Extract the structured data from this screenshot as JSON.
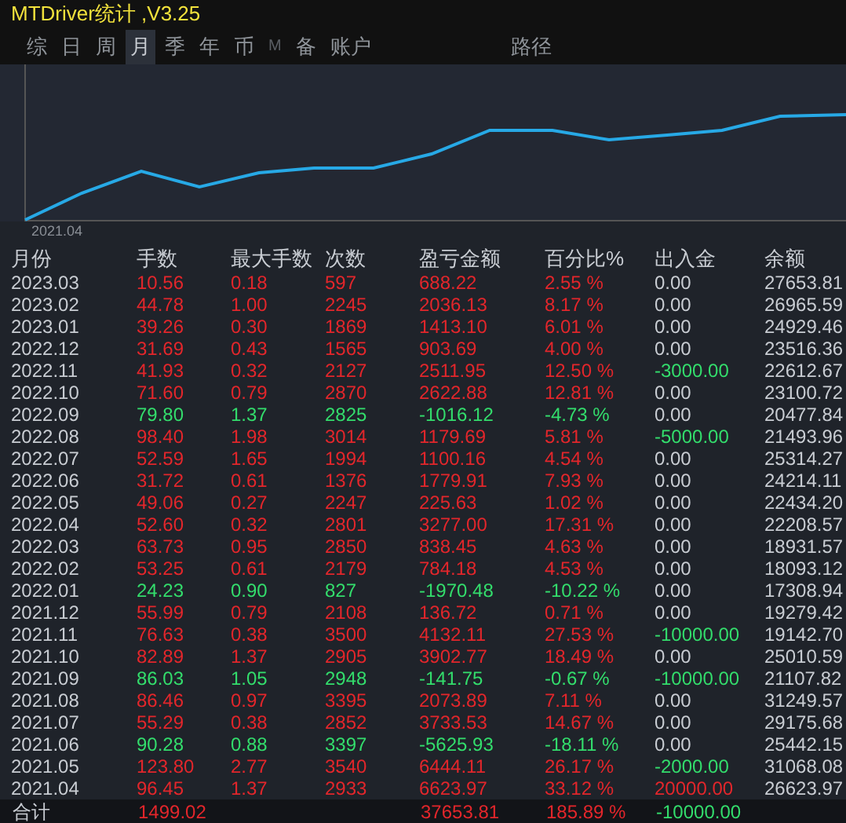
{
  "window": {
    "title": "MTDriver统计 ,V3.25"
  },
  "tabs": [
    {
      "label": "综",
      "selected": false,
      "disabled": false
    },
    {
      "label": "日",
      "selected": false,
      "disabled": false
    },
    {
      "label": "周",
      "selected": false,
      "disabled": false
    },
    {
      "label": "月",
      "selected": true,
      "disabled": false
    },
    {
      "label": "季",
      "selected": false,
      "disabled": false
    },
    {
      "label": "年",
      "selected": false,
      "disabled": false
    },
    {
      "label": "币",
      "selected": false,
      "disabled": false
    },
    {
      "label": "M",
      "selected": false,
      "disabled": true
    },
    {
      "label": "备",
      "selected": false,
      "disabled": false
    },
    {
      "label": "账户",
      "selected": false,
      "disabled": false
    },
    {
      "label": "路径",
      "selected": false,
      "disabled": false
    }
  ],
  "chart": {
    "x_label": "2021.04"
  },
  "table": {
    "columns": [
      "月份",
      "手数",
      "最大手数",
      "次数",
      "盈亏金额",
      "百分比%",
      "出入金",
      "余额"
    ],
    "rows": [
      {
        "cells": [
          "2023.03",
          "10.56",
          "0.18",
          "597",
          "688.22",
          "2.55 %",
          "0.00",
          "27653.81"
        ],
        "kind": "gain",
        "withdrawal": false,
        "deposit": false
      },
      {
        "cells": [
          "2023.02",
          "44.78",
          "1.00",
          "2245",
          "2036.13",
          "8.17 %",
          "0.00",
          "26965.59"
        ],
        "kind": "gain",
        "withdrawal": false,
        "deposit": false
      },
      {
        "cells": [
          "2023.01",
          "39.26",
          "0.30",
          "1869",
          "1413.10",
          "6.01 %",
          "0.00",
          "24929.46"
        ],
        "kind": "gain",
        "withdrawal": false,
        "deposit": false
      },
      {
        "cells": [
          "2022.12",
          "31.69",
          "0.43",
          "1565",
          "903.69",
          "4.00 %",
          "0.00",
          "23516.36"
        ],
        "kind": "gain",
        "withdrawal": false,
        "deposit": false
      },
      {
        "cells": [
          "2022.11",
          "41.93",
          "0.32",
          "2127",
          "2511.95",
          "12.50 %",
          "-3000.00",
          "22612.67"
        ],
        "kind": "gain",
        "withdrawal": true,
        "deposit": false
      },
      {
        "cells": [
          "2022.10",
          "71.60",
          "0.79",
          "2870",
          "2622.88",
          "12.81 %",
          "0.00",
          "23100.72"
        ],
        "kind": "gain",
        "withdrawal": false,
        "deposit": false
      },
      {
        "cells": [
          "2022.09",
          "79.80",
          "1.37",
          "2825",
          "-1016.12",
          "-4.73 %",
          "0.00",
          "20477.84"
        ],
        "kind": "loss",
        "withdrawal": false,
        "deposit": false
      },
      {
        "cells": [
          "2022.08",
          "98.40",
          "1.98",
          "3014",
          "1179.69",
          "5.81 %",
          "-5000.00",
          "21493.96"
        ],
        "kind": "gain",
        "withdrawal": true,
        "deposit": false
      },
      {
        "cells": [
          "2022.07",
          "52.59",
          "1.65",
          "1994",
          "1100.16",
          "4.54 %",
          "0.00",
          "25314.27"
        ],
        "kind": "gain",
        "withdrawal": false,
        "deposit": false
      },
      {
        "cells": [
          "2022.06",
          "31.72",
          "0.61",
          "1376",
          "1779.91",
          "7.93 %",
          "0.00",
          "24214.11"
        ],
        "kind": "gain",
        "withdrawal": false,
        "deposit": false
      },
      {
        "cells": [
          "2022.05",
          "49.06",
          "0.27",
          "2247",
          "225.63",
          "1.02 %",
          "0.00",
          "22434.20"
        ],
        "kind": "gain",
        "withdrawal": false,
        "deposit": false
      },
      {
        "cells": [
          "2022.04",
          "52.60",
          "0.32",
          "2801",
          "3277.00",
          "17.31 %",
          "0.00",
          "22208.57"
        ],
        "kind": "gain",
        "withdrawal": false,
        "deposit": false
      },
      {
        "cells": [
          "2022.03",
          "63.73",
          "0.95",
          "2850",
          "838.45",
          "4.63 %",
          "0.00",
          "18931.57"
        ],
        "kind": "gain",
        "withdrawal": false,
        "deposit": false
      },
      {
        "cells": [
          "2022.02",
          "53.25",
          "0.61",
          "2179",
          "784.18",
          "4.53 %",
          "0.00",
          "18093.12"
        ],
        "kind": "gain",
        "withdrawal": false,
        "deposit": false
      },
      {
        "cells": [
          "2022.01",
          "24.23",
          "0.90",
          "827",
          "-1970.48",
          "-10.22 %",
          "0.00",
          "17308.94"
        ],
        "kind": "loss",
        "withdrawal": false,
        "deposit": false
      },
      {
        "cells": [
          "2021.12",
          "55.99",
          "0.79",
          "2108",
          "136.72",
          "0.71 %",
          "0.00",
          "19279.42"
        ],
        "kind": "gain",
        "withdrawal": false,
        "deposit": false
      },
      {
        "cells": [
          "2021.11",
          "76.63",
          "0.38",
          "3500",
          "4132.11",
          "27.53 %",
          "-10000.00",
          "19142.70"
        ],
        "kind": "gain",
        "withdrawal": true,
        "deposit": false
      },
      {
        "cells": [
          "2021.10",
          "82.89",
          "1.37",
          "2905",
          "3902.77",
          "18.49 %",
          "0.00",
          "25010.59"
        ],
        "kind": "gain",
        "withdrawal": false,
        "deposit": false
      },
      {
        "cells": [
          "2021.09",
          "86.03",
          "1.05",
          "2948",
          "-141.75",
          "-0.67 %",
          "-10000.00",
          "21107.82"
        ],
        "kind": "loss",
        "withdrawal": true,
        "deposit": false
      },
      {
        "cells": [
          "2021.08",
          "86.46",
          "0.97",
          "3395",
          "2073.89",
          "7.11 %",
          "0.00",
          "31249.57"
        ],
        "kind": "gain",
        "withdrawal": false,
        "deposit": false
      },
      {
        "cells": [
          "2021.07",
          "55.29",
          "0.38",
          "2852",
          "3733.53",
          "14.67 %",
          "0.00",
          "29175.68"
        ],
        "kind": "gain",
        "withdrawal": false,
        "deposit": false
      },
      {
        "cells": [
          "2021.06",
          "90.28",
          "0.88",
          "3397",
          "-5625.93",
          "-18.11 %",
          "0.00",
          "25442.15"
        ],
        "kind": "loss",
        "withdrawal": false,
        "deposit": false
      },
      {
        "cells": [
          "2021.05",
          "123.80",
          "2.77",
          "3540",
          "6444.11",
          "26.17 %",
          "-2000.00",
          "31068.08"
        ],
        "kind": "gain",
        "withdrawal": true,
        "deposit": false
      },
      {
        "cells": [
          "2021.04",
          "96.45",
          "1.37",
          "2933",
          "6623.97",
          "33.12 %",
          "20000.00",
          "26623.97"
        ],
        "kind": "gain",
        "withdrawal": false,
        "deposit": true
      }
    ],
    "total": {
      "label": "合计",
      "lots": "1499.02",
      "profit": "37653.81",
      "percent": "185.89 %",
      "flow": "-10000.00"
    }
  }
}
